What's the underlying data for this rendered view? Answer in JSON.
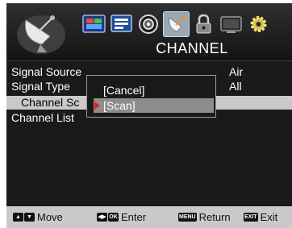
{
  "header": {
    "title": "CHANNEL",
    "menu_icons": [
      "picture-icon",
      "screen-icon",
      "sound-icon",
      "channel-icon",
      "lock-icon",
      "setup-icon",
      "settings-icon"
    ]
  },
  "menu": {
    "items": [
      {
        "label": "Signal Source",
        "value": "Air"
      },
      {
        "label": "Signal Type",
        "value": "All"
      },
      {
        "label": "Channel Sc",
        "value": ""
      },
      {
        "label": "Channel List",
        "value": ""
      }
    ],
    "selected_index": 2
  },
  "popup": {
    "options": [
      "[Cancel]",
      "[Scan]"
    ],
    "highlighted_index": 1
  },
  "footer": {
    "move": {
      "keys": [
        "▲",
        "▼"
      ],
      "label": "Move"
    },
    "enter": {
      "keys": [
        "◀▶",
        "OK"
      ],
      "label": "Enter"
    },
    "return": {
      "keys": [
        "MENU"
      ],
      "label": "Return"
    },
    "exit": {
      "keys": [
        "EXIT"
      ],
      "label": "Exit"
    }
  },
  "colors": {
    "screen_bg": "#1a1a1a",
    "selected_row": "#c9c9c9",
    "popup_highlight": "#8d8d8d",
    "pointer": "#e02020",
    "footer_bg": "#c9c9c9"
  }
}
